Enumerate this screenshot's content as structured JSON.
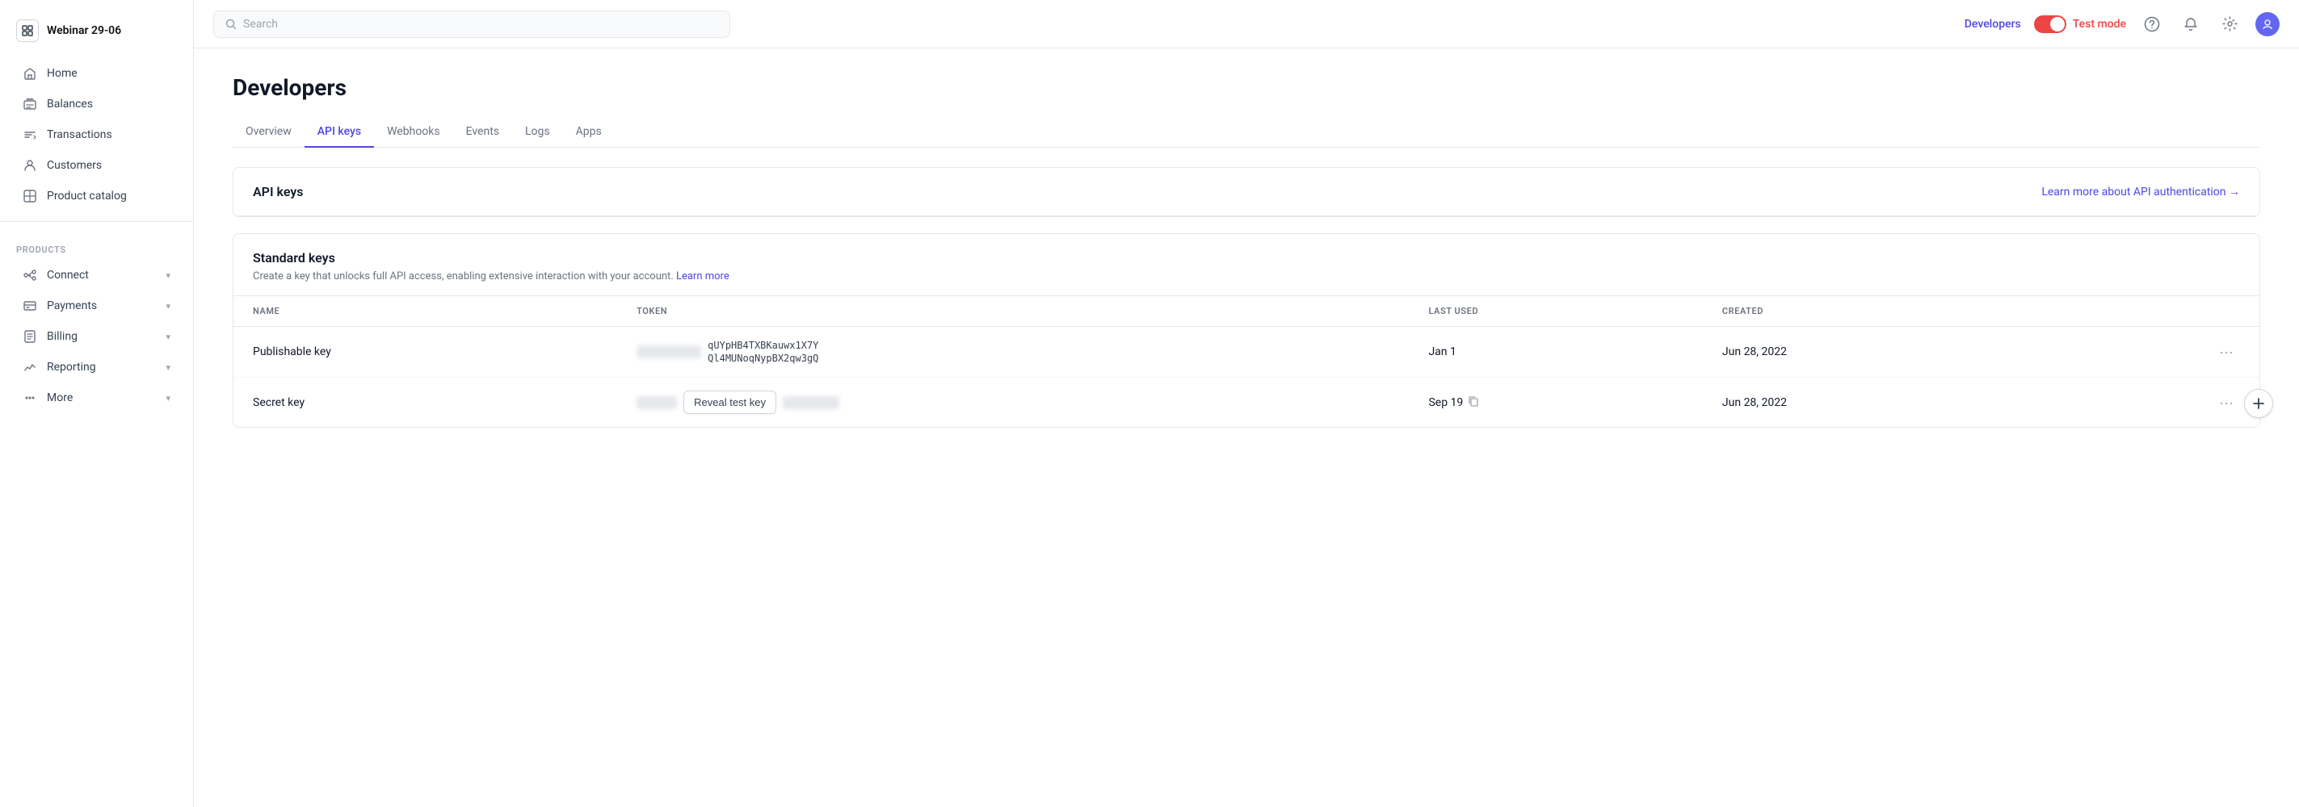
{
  "sidebar": {
    "workspace_name": "Webinar 29-06",
    "nav_items": [
      {
        "id": "home",
        "label": "Home",
        "icon": "home"
      },
      {
        "id": "balances",
        "label": "Balances",
        "icon": "balances"
      },
      {
        "id": "transactions",
        "label": "Transactions",
        "icon": "transactions"
      },
      {
        "id": "customers",
        "label": "Customers",
        "icon": "customers"
      },
      {
        "id": "product-catalog",
        "label": "Product catalog",
        "icon": "box"
      }
    ],
    "products_label": "Products",
    "products_items": [
      {
        "id": "connect",
        "label": "Connect",
        "icon": "connect",
        "has_chevron": true
      },
      {
        "id": "payments",
        "label": "Payments",
        "icon": "payments",
        "has_chevron": true
      },
      {
        "id": "billing",
        "label": "Billing",
        "icon": "billing",
        "has_chevron": true
      },
      {
        "id": "reporting",
        "label": "Reporting",
        "icon": "reporting",
        "has_chevron": true
      },
      {
        "id": "more",
        "label": "More",
        "icon": "more",
        "has_chevron": true
      }
    ]
  },
  "header": {
    "search_placeholder": "Search",
    "developers_label": "Developers",
    "test_mode_label": "Test mode",
    "toggle_state": "on"
  },
  "page": {
    "title": "Developers",
    "tabs": [
      {
        "id": "overview",
        "label": "Overview",
        "active": false
      },
      {
        "id": "api-keys",
        "label": "API keys",
        "active": true
      },
      {
        "id": "webhooks",
        "label": "Webhooks",
        "active": false
      },
      {
        "id": "events",
        "label": "Events",
        "active": false
      },
      {
        "id": "logs",
        "label": "Logs",
        "active": false
      },
      {
        "id": "apps",
        "label": "Apps",
        "active": false
      }
    ]
  },
  "api_keys_section": {
    "title": "API keys",
    "learn_more_text": "Learn more about API authentication →"
  },
  "standard_keys": {
    "title": "Standard keys",
    "description": "Create a key that unlocks full API access, enabling extensive interaction with your account.",
    "learn_more_label": "Learn more",
    "table": {
      "columns": [
        {
          "id": "name",
          "label": "NAME"
        },
        {
          "id": "token",
          "label": "TOKEN"
        },
        {
          "id": "last_used",
          "label": "LAST USED"
        },
        {
          "id": "created",
          "label": "CREATED"
        },
        {
          "id": "actions",
          "label": ""
        }
      ],
      "rows": [
        {
          "id": "publishable-key",
          "name": "Publishable key",
          "token_visible": "pk_test_...qUYpHB4TXBKauwx1X7Y",
          "token_line2": "...Ql4MUNoqNypBX2qw3gQ",
          "has_blur": true,
          "last_used": "Jan 1",
          "created": "Jun 28, 2022"
        },
        {
          "id": "secret-key",
          "name": "Secret key",
          "token_visible": "",
          "has_blur": true,
          "reveal_btn": "Reveal test key",
          "last_used": "Sep 19",
          "has_copy_icon": true,
          "created": "Jun 28, 2022"
        }
      ]
    }
  }
}
